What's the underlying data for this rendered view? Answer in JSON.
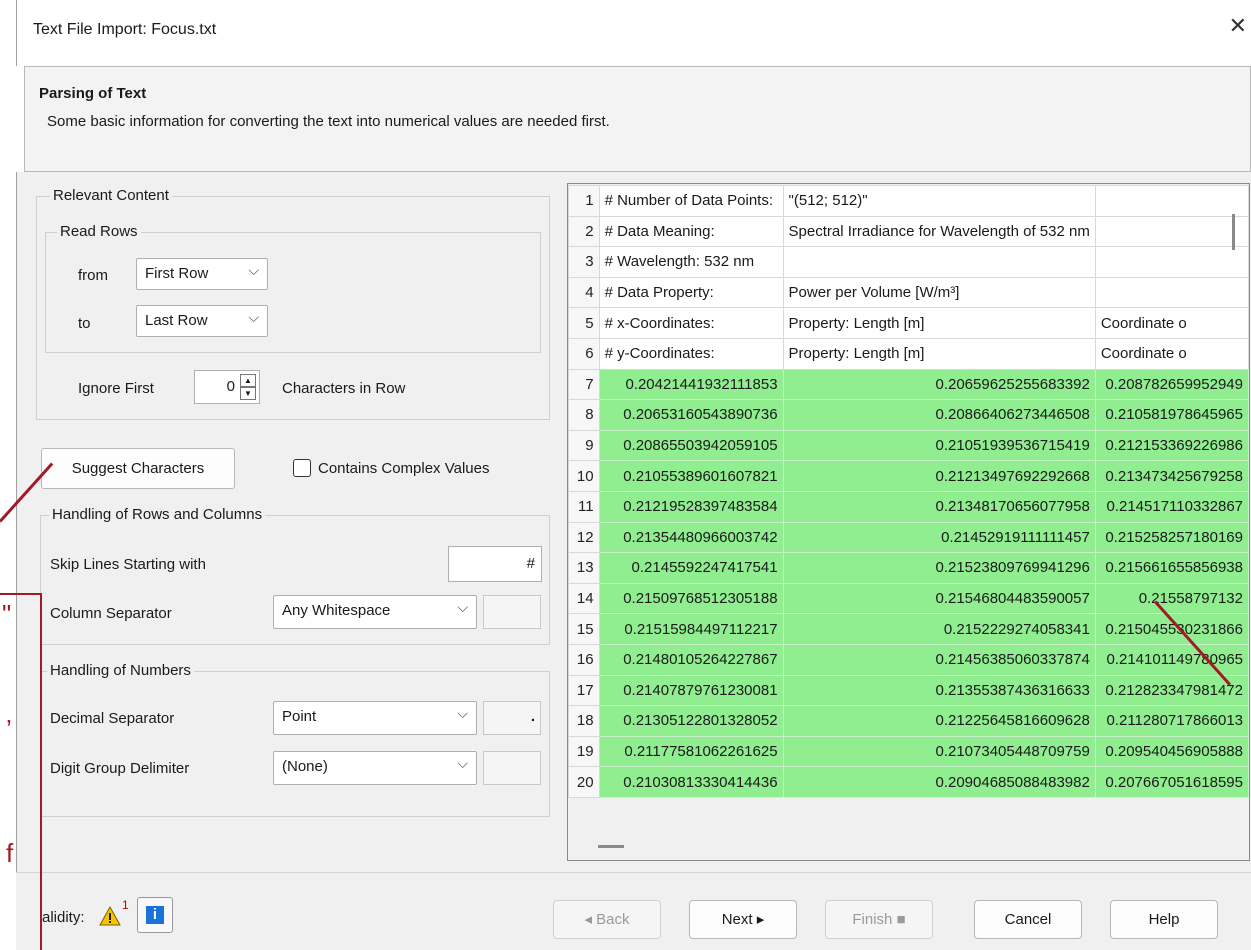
{
  "window": {
    "title": "Text File Import: Focus.txt",
    "close_glyph": "✕"
  },
  "header": {
    "title": "Parsing of Text",
    "subtitle": "Some basic information for converting the text into numerical values are needed first."
  },
  "relevant_content": {
    "group_label": "Relevant Content",
    "read_rows_label": "Read Rows",
    "from_label": "from",
    "from_value": "First Row",
    "to_label": "to",
    "to_value": "Last Row",
    "ignore_first_label": "Ignore First",
    "ignore_first_value": "0",
    "characters_label": "Characters in Row"
  },
  "suggest_button": "Suggest Characters",
  "complex_values": {
    "label": "Contains Complex Values",
    "checked": false
  },
  "rows_columns": {
    "group_label": "Handling of Rows and Columns",
    "skip_label": "Skip Lines Starting with",
    "skip_value": "#",
    "separator_label": "Column Separator",
    "separator_value": "Any Whitespace"
  },
  "numbers": {
    "group_label": "Handling of Numbers",
    "decimal_label": "Decimal Separator",
    "decimal_value": "Point",
    "decimal_char": ".",
    "digit_label": "Digit Group Delimiter",
    "digit_value": "(None)"
  },
  "grid": {
    "header_rows": [
      {
        "n": "1",
        "c1": "# Number of Data Points:",
        "c2": "\"(512; 512)\"",
        "c3": ""
      },
      {
        "n": "2",
        "c1": "# Data Meaning:",
        "c2": "Spectral Irradiance for Wavelength of 532 nm",
        "c3": ""
      },
      {
        "n": "3",
        "c1": "# Wavelength:  532 nm",
        "c2": "",
        "c3": ""
      },
      {
        "n": "4",
        "c1": "# Data Property:",
        "c2": "Power per Volume [W/m³]",
        "c3": ""
      },
      {
        "n": "5",
        "c1": "# x-Coordinates:",
        "c2": "Property: Length [m]",
        "c3": "Coordinate o"
      },
      {
        "n": "6",
        "c1": "# y-Coordinates:",
        "c2": "Property: Length [m]",
        "c3": "Coordinate o"
      }
    ],
    "data_rows": [
      {
        "n": "7",
        "c1": "0.20421441932111853",
        "c2": "0.20659625255683392",
        "c3": "0.208782659952949"
      },
      {
        "n": "8",
        "c1": "0.20653160543890736",
        "c2": "0.20866406273446508",
        "c3": "0.210581978645965"
      },
      {
        "n": "9",
        "c1": "0.20865503942059105",
        "c2": "0.21051939536715419",
        "c3": "0.212153369226986"
      },
      {
        "n": "10",
        "c1": "0.21055389601607821",
        "c2": "0.21213497692292668",
        "c3": "0.213473425679258"
      },
      {
        "n": "11",
        "c1": "0.21219528397483584",
        "c2": "0.21348170656077958",
        "c3": "0.214517110332867"
      },
      {
        "n": "12",
        "c1": "0.21354480966003742",
        "c2": "0.21452919111111457",
        "c3": "0.215258257180169"
      },
      {
        "n": "13",
        "c1": "0.2145592247417541",
        "c2": "0.21523809769941296",
        "c3": "0.215661655856938"
      },
      {
        "n": "14",
        "c1": "0.21509768512305188",
        "c2": "0.21546804483590057",
        "c3": "0.21558797132"
      },
      {
        "n": "15",
        "c1": "0.21515984497112217",
        "c2": "0.2152229274058341",
        "c3": "0.215045530231866"
      },
      {
        "n": "16",
        "c1": "0.21480105264227867",
        "c2": "0.21456385060337874",
        "c3": "0.214101149780965"
      },
      {
        "n": "17",
        "c1": "0.21407879761230081",
        "c2": "0.21355387436316633",
        "c3": "0.212823347981472"
      },
      {
        "n": "18",
        "c1": "0.21305122801328052",
        "c2": "0.21225645816609628",
        "c3": "0.211280717866013"
      },
      {
        "n": "19",
        "c1": "0.21177581062261625",
        "c2": "0.21073405448709759",
        "c3": "0.209540456905888"
      },
      {
        "n": "20",
        "c1": "0.21030813330414436",
        "c2": "0.20904685088483982",
        "c3": "0.207667051618595"
      }
    ]
  },
  "footer": {
    "validity_label": "alidity:",
    "warning_count": "1",
    "info_glyph": "i",
    "back": "◂ Back",
    "next": "Next ▸",
    "finish": "Finish ■",
    "cancel": "Cancel",
    "help": "Help"
  },
  "callout": {
    "quote": "\"",
    "comma": "’",
    "letter": "f"
  },
  "colors": {
    "data_cell": "#90ee90",
    "callout": "#a11a26",
    "info": "#1a73d9",
    "warning": "#f5c400"
  }
}
